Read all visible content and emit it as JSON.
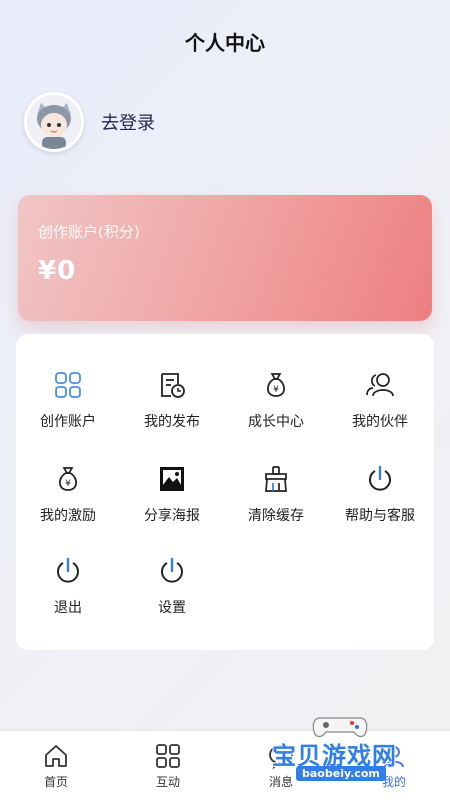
{
  "header": {
    "title": "个人中心"
  },
  "profile": {
    "login_label": "去登录"
  },
  "wallet": {
    "label": "创作账户(积分)",
    "amount": "¥0"
  },
  "menu": {
    "items": [
      {
        "label": "创作账户",
        "icon": "grid-icon"
      },
      {
        "label": "我的发布",
        "icon": "document-clock-icon"
      },
      {
        "label": "成长中心",
        "icon": "money-bag-icon"
      },
      {
        "label": "我的伙伴",
        "icon": "people-icon"
      },
      {
        "label": "我的激励",
        "icon": "money-bag-icon"
      },
      {
        "label": "分享海报",
        "icon": "image-icon"
      },
      {
        "label": "清除缓存",
        "icon": "broom-icon"
      },
      {
        "label": "帮助与客服",
        "icon": "power-icon"
      },
      {
        "label": "退出",
        "icon": "power-icon"
      },
      {
        "label": "设置",
        "icon": "power-icon"
      }
    ]
  },
  "tabbar": {
    "tabs": [
      {
        "label": "首页",
        "icon": "home-icon"
      },
      {
        "label": "互动",
        "icon": "grid-icon"
      },
      {
        "label": "消息",
        "icon": "chat-icon"
      },
      {
        "label": "我的",
        "icon": "user-icon",
        "active": true
      }
    ]
  },
  "watermark": {
    "text": "宝贝游戏网",
    "url": "baobeiy.com"
  },
  "colors": {
    "accent": "#3a6ee8",
    "card_start": "#f1c6c6",
    "card_end": "#ee7f80"
  }
}
